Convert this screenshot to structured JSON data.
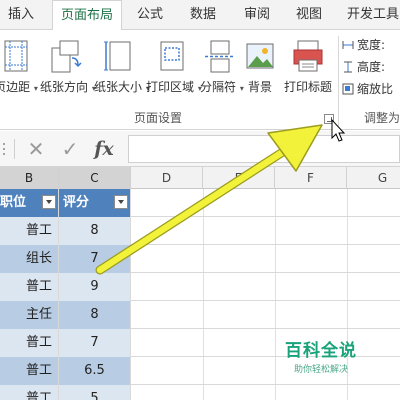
{
  "tabs": [
    {
      "label": "插入",
      "active": false
    },
    {
      "label": "页面布局",
      "active": true
    },
    {
      "label": "公式",
      "active": false
    },
    {
      "label": "数据",
      "active": false
    },
    {
      "label": "审阅",
      "active": false
    },
    {
      "label": "视图",
      "active": false
    },
    {
      "label": "开发工具",
      "active": false
    }
  ],
  "ribbon": {
    "buttons": [
      {
        "label": "页边距",
        "icon": "margins-icon"
      },
      {
        "label": "纸张方向",
        "icon": "orientation-icon"
      },
      {
        "label": "纸张大小",
        "icon": "size-icon"
      },
      {
        "label": "打印区域",
        "icon": "print-area-icon"
      },
      {
        "label": "分隔符",
        "icon": "breaks-icon"
      },
      {
        "label": "背景",
        "icon": "background-icon"
      },
      {
        "label": "打印标题",
        "icon": "print-titles-icon"
      }
    ],
    "group_page_setup": "页面设置",
    "group_scale": "调整为",
    "scale_width": "宽度:",
    "scale_height": "高度:",
    "scale_ratio": "缩放比"
  },
  "formula_bar": {
    "cancel_icon": "close-icon",
    "confirm_icon": "check-icon",
    "fx_label": "fx",
    "value": ""
  },
  "columns": [
    "B",
    "C",
    "D",
    "E",
    "F",
    "G"
  ],
  "table": {
    "headers": [
      "职位",
      "评分"
    ],
    "rows": [
      [
        "普工",
        "8"
      ],
      [
        "组长",
        "7"
      ],
      [
        "普工",
        "9"
      ],
      [
        "主任",
        "8"
      ],
      [
        "普工",
        "7"
      ],
      [
        "普工",
        "6.5"
      ],
      [
        "普工",
        "5"
      ]
    ]
  },
  "watermark": {
    "title": "百科全说",
    "subtitle": "助你轻松解决"
  },
  "colors": {
    "accent_tab": "#1e7145",
    "table_header": "#4f81bd",
    "table_band_light": "#dce6f1",
    "table_band_dark": "#b8cce4",
    "arrow": "#f2f23a"
  }
}
